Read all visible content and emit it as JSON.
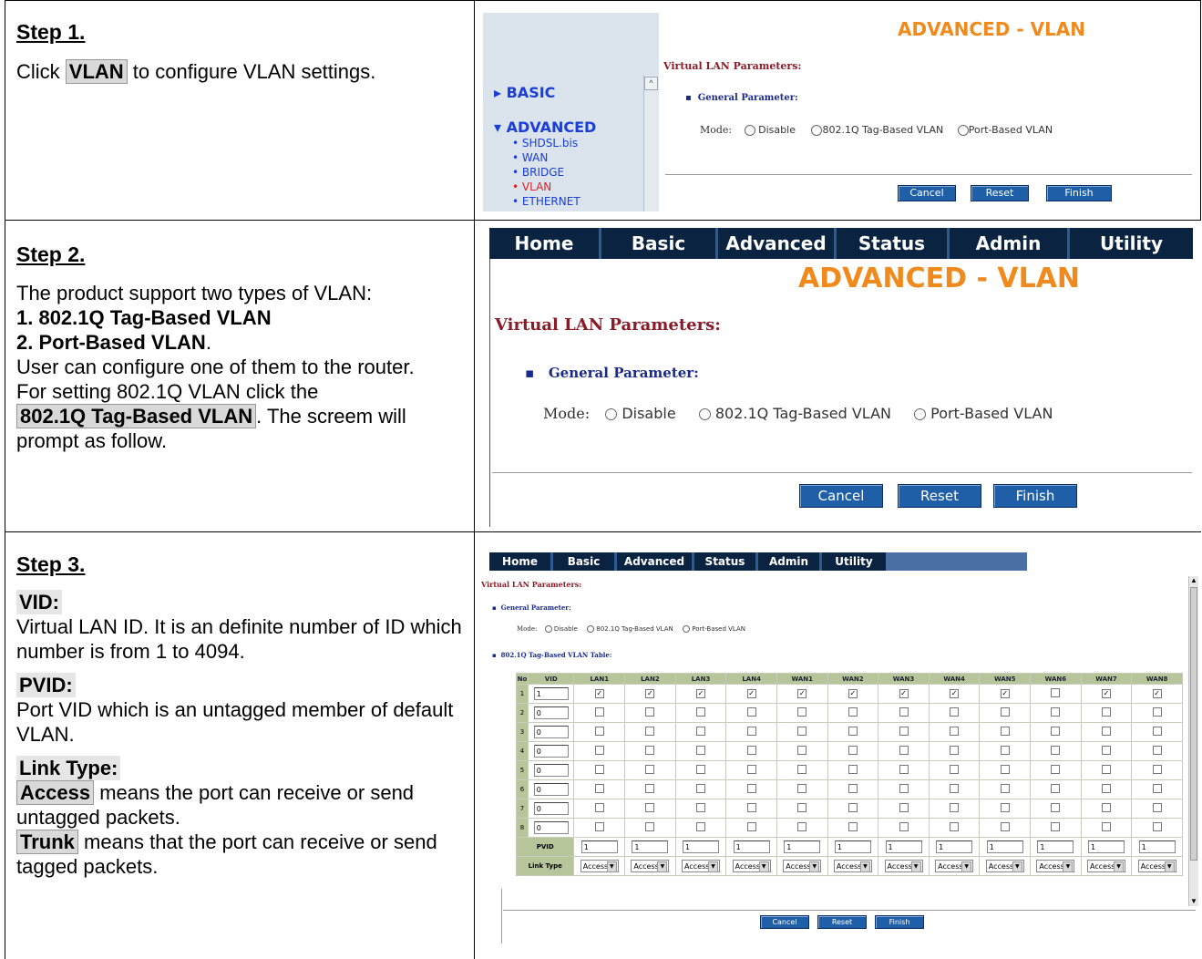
{
  "steps": [
    {
      "title": "Step 1.",
      "text_pre": "Click ",
      "text_hl": "VLAN",
      "text_post": " to configure VLAN settings."
    },
    {
      "title": "Step 2.",
      "line1": "The product support two types of VLAN:",
      "line2": "1. 802.1Q Tag-Based VLAN",
      "line3": "2. Port-Based VLAN",
      "line3_post": ".",
      "line4": "User can configure one of them to the router.",
      "line5": "For setting 802.1Q VLAN click the",
      "line6_hl": "802.1Q Tag-Based VLAN",
      "line6_post": ". The screem will prompt as follow."
    },
    {
      "title": "Step 3.",
      "vid_head": "VID:",
      "vid_text": "Virtual LAN ID. It is an definite number of ID which number is from 1 to 4094.",
      "pvid_head": "PVID:",
      "pvid_text": "Port VID which is an untagged member of default VLAN.",
      "link_head": "Link Type:",
      "access_hl": "Access",
      "access_text": " means the port can receive or send untagged packets.",
      "trunk_hl": "Trunk",
      "trunk_text": " means that the port can receive or send tagged packets."
    }
  ],
  "panel1": {
    "basic": "BASIC",
    "advanced": "ADVANCED",
    "sub_items": [
      "SHDSL.bis",
      "WAN",
      "BRIDGE",
      "VLAN",
      "ETHERNET"
    ],
    "title": "ADVANCED - VLAN",
    "vlp": "Virtual LAN Parameters:",
    "gp": "General Parameter:",
    "mode_label": "Mode:",
    "modes": [
      "Disable",
      "802.1Q Tag-Based VLAN",
      "Port-Based VLAN"
    ],
    "buttons": [
      "Cancel",
      "Reset",
      "Finish"
    ]
  },
  "panel2": {
    "nav": [
      "Home",
      "Basic",
      "Advanced",
      "Status",
      "Admin",
      "Utility"
    ],
    "title": "ADVANCED - VLAN",
    "vlp": "Virtual LAN Parameters:",
    "gp": "General Parameter:",
    "mode_label": "Mode:",
    "modes": [
      "Disable",
      "802.1Q Tag-Based VLAN",
      "Port-Based VLAN"
    ],
    "buttons": [
      "Cancel",
      "Reset",
      "Finish"
    ]
  },
  "panel3": {
    "nav": [
      "Home",
      "Basic",
      "Advanced",
      "Status",
      "Admin",
      "Utility"
    ],
    "vlp": "Virtual LAN Parameters:",
    "gp": "General Parameter:",
    "mode_label": "Mode:",
    "modes": [
      "Disable",
      "802.1Q Tag-Based VLAN",
      "Port-Based VLAN"
    ],
    "table_title": "802.1Q Tag-Based VLAN Table:",
    "headers": [
      "No",
      "VID",
      "LAN1",
      "LAN2",
      "LAN3",
      "LAN4",
      "WAN1",
      "WAN2",
      "WAN3",
      "WAN4",
      "WAN5",
      "WAN6",
      "WAN7",
      "WAN8"
    ],
    "rows": [
      {
        "no": "1",
        "vid": "1",
        "checks": [
          true,
          true,
          true,
          true,
          true,
          true,
          true,
          true,
          true,
          false,
          true,
          true
        ]
      },
      {
        "no": "2",
        "vid": "0",
        "checks": [
          false,
          false,
          false,
          false,
          false,
          false,
          false,
          false,
          false,
          false,
          false,
          false
        ]
      },
      {
        "no": "3",
        "vid": "0",
        "checks": [
          false,
          false,
          false,
          false,
          false,
          false,
          false,
          false,
          false,
          false,
          false,
          false
        ]
      },
      {
        "no": "4",
        "vid": "0",
        "checks": [
          false,
          false,
          false,
          false,
          false,
          false,
          false,
          false,
          false,
          false,
          false,
          false
        ]
      },
      {
        "no": "5",
        "vid": "0",
        "checks": [
          false,
          false,
          false,
          false,
          false,
          false,
          false,
          false,
          false,
          false,
          false,
          false
        ]
      },
      {
        "no": "6",
        "vid": "0",
        "checks": [
          false,
          false,
          false,
          false,
          false,
          false,
          false,
          false,
          false,
          false,
          false,
          false
        ]
      },
      {
        "no": "7",
        "vid": "0",
        "checks": [
          false,
          false,
          false,
          false,
          false,
          false,
          false,
          false,
          false,
          false,
          false,
          false
        ]
      },
      {
        "no": "8",
        "vid": "0",
        "checks": [
          false,
          false,
          false,
          false,
          false,
          false,
          false,
          false,
          false,
          false,
          false,
          false
        ]
      }
    ],
    "pvid_label": "PVID",
    "pvid_values": [
      "1",
      "1",
      "1",
      "1",
      "1",
      "1",
      "1",
      "1",
      "1",
      "1",
      "1",
      "1"
    ],
    "link_label": "Link Type",
    "link_values": [
      "Access",
      "Access",
      "Access",
      "Access",
      "Access",
      "Access",
      "Access",
      "Access",
      "Access",
      "Access",
      "Access",
      "Access"
    ],
    "buttons": [
      "Cancel",
      "Reset",
      "Finish"
    ]
  },
  "colors": {
    "nav_bg": "#0a2340",
    "title_orange": "#f08a1c",
    "button_blue": "#1f5fa8",
    "table_head": "#b7c59b"
  }
}
